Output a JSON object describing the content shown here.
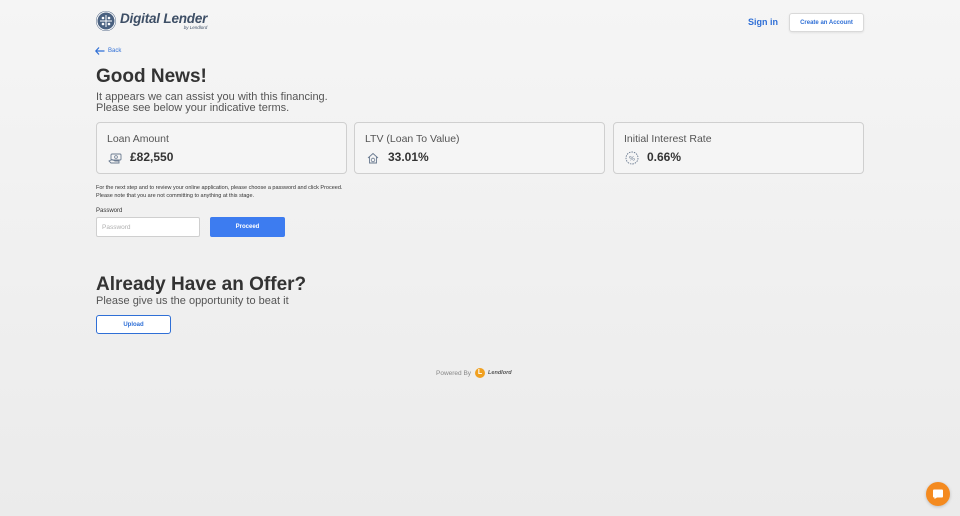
{
  "header": {
    "logo_title": "Digital Lender",
    "logo_sub": "by Lendlord",
    "signin_label": "Sign in",
    "create_account_label": "Create an Account"
  },
  "back_label": "Back",
  "headline": "Good News!",
  "subline": [
    "It appears we can assist you with this financing.",
    "Please see below your indicative terms."
  ],
  "cards": [
    {
      "label": "Loan Amount",
      "value": "£82,550",
      "icon": "cash-icon"
    },
    {
      "label": "LTV (Loan To Value)",
      "value": "33.01%",
      "icon": "house-coin-icon"
    },
    {
      "label": "Initial Interest Rate",
      "value": "0.66%",
      "icon": "percent-badge-icon"
    }
  ],
  "note": [
    "For the next step and to review your online application, please choose a password and click Proceed.",
    "Please note that you are not committing to anything at this stage."
  ],
  "password": {
    "label": "Password",
    "placeholder": "Password"
  },
  "proceed_label": "Proceed",
  "offer": {
    "title": "Already Have an Offer?",
    "subtitle": "Please give us the opportunity to beat it",
    "upload_label": "Upload"
  },
  "footer": {
    "powered_label": "Powered By",
    "brand": "Lendlord",
    "brand_mark": "L"
  },
  "colors": {
    "accent": "#3d7cf0",
    "link": "#2f6fd6",
    "chat": "#f48a1f"
  }
}
